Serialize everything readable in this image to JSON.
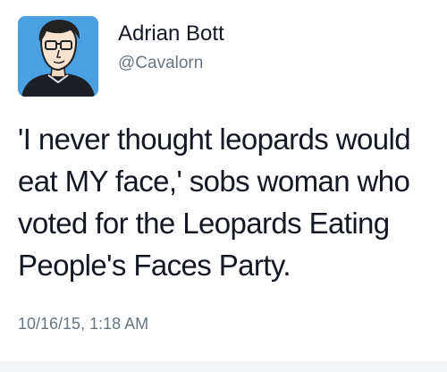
{
  "tweet": {
    "author": {
      "display_name": "Adrian Bott",
      "handle": "@Cavalorn",
      "avatar_icon": "cartoon-man-with-glasses-avatar"
    },
    "text": "'I never thought leopards would\neat MY face,' sobs woman who\nvoted for the Leopards Eating\nPeople's Faces Party.",
    "timestamp": "10/16/15, 1:18 AM"
  },
  "colors": {
    "avatar_background": "#4aa0e0",
    "name": "#141823",
    "secondary_text": "#687682",
    "background": "#ffffff"
  }
}
